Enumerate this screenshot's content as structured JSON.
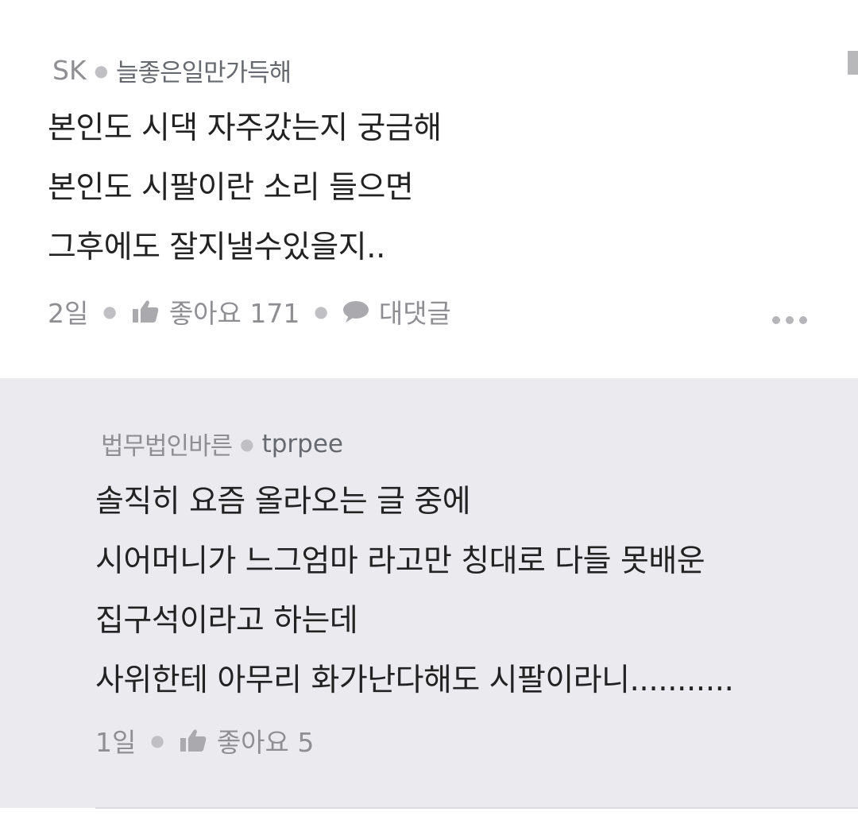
{
  "comment": {
    "author": "SK",
    "nickname": "늘좋은일만가득해",
    "lines": [
      "본인도 시댁 자주갔는지  궁금해",
      "본인도 시팔이란 소리 들으면",
      "그후에도  잘지낼수있을지.."
    ],
    "time": "2일",
    "like_label": "좋아요 171",
    "reply_label": "대댓글",
    "icons": {
      "like": "thumbs-up-icon",
      "reply": "speech-bubble-icon",
      "more": "more-dots-icon"
    }
  },
  "reply": {
    "author": "법무법인바른",
    "nickname": "tprpee",
    "lines": [
      "솔직히 요즘 올라오는 글 중에",
      "시어머니가 느그엄마 라고만 칭대로 다들 못배운",
      "집구석이라고 하는데",
      "사위한테 아무리 화가난다해도 시팔이라니..........."
    ],
    "time": "1일",
    "like_label": "좋아요 5",
    "icons": {
      "like": "thumbs-up-icon"
    }
  },
  "colors": {
    "text": "#222222",
    "meta": "#8e8e93",
    "reply_background": "#ebebef",
    "background": "#ffffff"
  }
}
